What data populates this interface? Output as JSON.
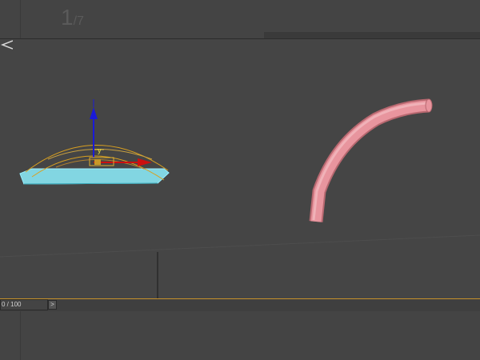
{
  "toolbar": {
    "page_current": "1",
    "page_total": "/7"
  },
  "viewport": {
    "gizmo_axis_label": "y",
    "colors": {
      "background": "#454545",
      "selected_object": "#7fd3e0",
      "tube_object": "#e8959e",
      "axis_x": "#cc1010",
      "axis_y": "#1a1ad8",
      "gizmo_ring": "#d9a020"
    },
    "icons": [
      "eye-icon"
    ]
  },
  "timeline": {
    "slider_value": "0 / 100",
    "next_label": ">"
  }
}
